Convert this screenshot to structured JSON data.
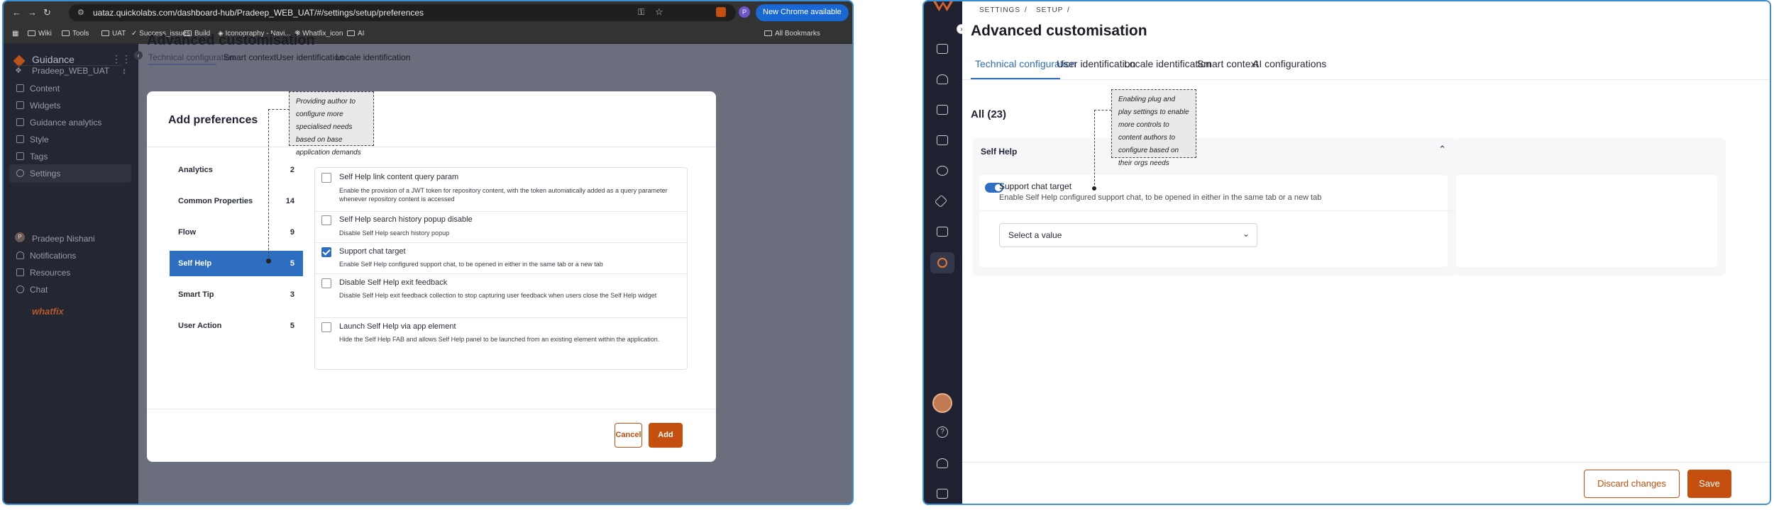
{
  "browser": {
    "url": "uataz.quickolabs.com/dashboard-hub/Pradeep_WEB_UAT/#/settings/setup/preferences",
    "new_chrome": "New Chrome available",
    "profile_initial": "P",
    "bookmarks": [
      "Wiki",
      "Tools",
      "UAT",
      "Success_issues",
      "Build",
      "Iconography - Navi...",
      "Whatfix_icon",
      "AI"
    ],
    "all_bookmarks": "All Bookmarks"
  },
  "left_app": {
    "brand": "Guidance",
    "workspace": "Pradeep_WEB_UAT",
    "nav": [
      "Content",
      "Widgets",
      "Guidance analytics",
      "Style",
      "Tags",
      "Settings"
    ],
    "bottom_nav": [
      "Pradeep Nishani",
      "Notifications",
      "Resources",
      "Chat"
    ],
    "user_initial": "P",
    "footer_logo": "whatfix",
    "page_title": "Advanced customisation",
    "tabs": [
      "Technical configuration",
      "Smart context",
      "User identification",
      "Locale identification"
    ]
  },
  "modal": {
    "title": "Add preferences",
    "categories": [
      {
        "label": "Analytics",
        "count": "2"
      },
      {
        "label": "Common Properties",
        "count": "14"
      },
      {
        "label": "Flow",
        "count": "9"
      },
      {
        "label": "Self Help",
        "count": "5"
      },
      {
        "label": "Smart Tip",
        "count": "3"
      },
      {
        "label": "User Action",
        "count": "5"
      }
    ],
    "options": [
      {
        "title": "Self Help link content query param",
        "desc": "Enable the provision of a JWT token for repository content, with the token automatically added as a query parameter whenever repository content is accessed",
        "checked": false
      },
      {
        "title": "Self Help search history popup disable",
        "desc": "Disable Self Help search history popup",
        "checked": false
      },
      {
        "title": "Support chat target",
        "desc": "Enable Self Help configured support chat, to be opened in either in the same tab or a new tab",
        "checked": true
      },
      {
        "title": "Disable Self Help exit feedback",
        "desc": "Disable Self Help exit feedback collection to stop capturing user feedback when users close the Self Help widget",
        "checked": false
      },
      {
        "title": "Launch Self Help via app element",
        "desc": "Hide the Self Help FAB and allows Self Help panel to be launched from an existing element within the application.",
        "checked": false
      }
    ],
    "cancel": "Cancel",
    "add": "Add",
    "callout": "Providing author to configure more specialised needs based on base application demands"
  },
  "right_app": {
    "breadcrumb": [
      "SETTINGS",
      "/",
      "SETUP",
      "/"
    ],
    "page_title": "Advanced customisation",
    "tabs": [
      "Technical configuration",
      "User identification",
      "Locale identification",
      "Smart context",
      "AI configurations"
    ],
    "all_count": "All (23)",
    "section": "Self Help",
    "setting_title": "Support chat target",
    "setting_desc": "Enable Self Help configured support chat, to be opened in either in the same tab or a new tab",
    "select_placeholder": "Select a value",
    "callout": "Enabling plug and play settings to enable more controls to content authors to configure based on their orgs needs",
    "discard": "Discard changes",
    "save": "Save"
  },
  "colors": {
    "accent": "#2e6ec1",
    "brand_orange": "#c44f0e",
    "sidebar": "#1f2130"
  }
}
